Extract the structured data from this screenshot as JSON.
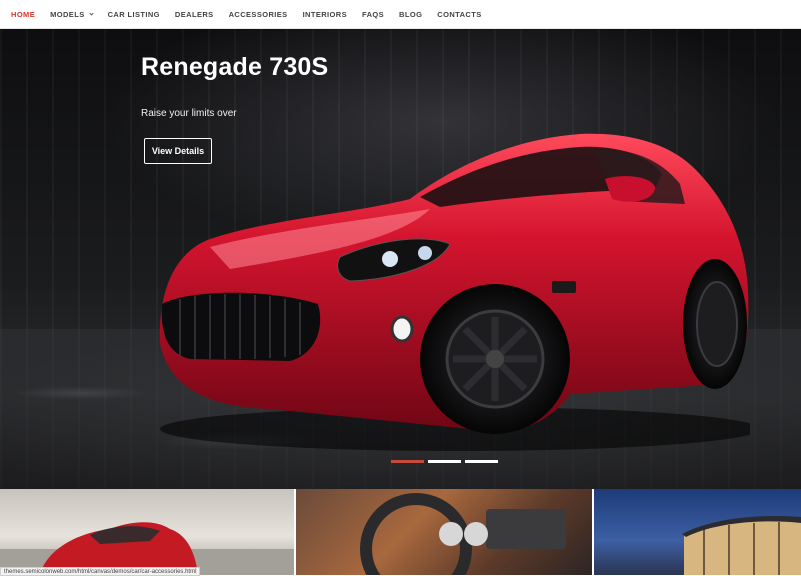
{
  "nav": {
    "items": [
      {
        "label": "HOME",
        "active": true
      },
      {
        "label": "MODELS",
        "dropdown": true
      },
      {
        "label": "CAR LISTING"
      },
      {
        "label": "DEALERS"
      },
      {
        "label": "ACCESSORIES"
      },
      {
        "label": "INTERIORS"
      },
      {
        "label": "FAQS"
      },
      {
        "label": "BLOG"
      },
      {
        "label": "CONTACTS"
      }
    ]
  },
  "hero": {
    "title": "Renegade 730S",
    "subtitle": "Raise your limits over",
    "button_label": "View Details",
    "slides_total": 3,
    "active_slide": 1
  },
  "thumbnails": [
    {
      "subject": "red-car-image"
    },
    {
      "subject": "car-interior-image"
    },
    {
      "subject": "dealership-building-image"
    }
  ],
  "status_bar": {
    "url": "themes.semicolonweb.com/html/canvas/demos/car/car-accessories.html"
  },
  "colors": {
    "accent": "#d9352b",
    "car_red": "#c8102e",
    "hero_bg": "#1b1c1e"
  }
}
